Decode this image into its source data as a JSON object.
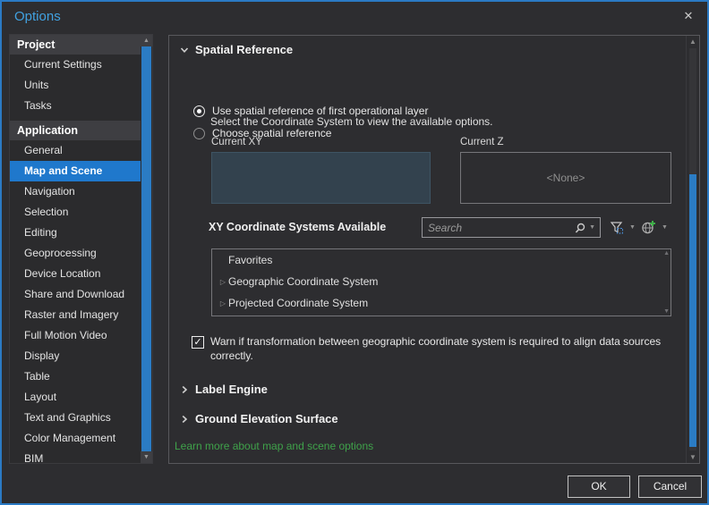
{
  "window": {
    "title": "Options",
    "close": "✕"
  },
  "sidebar": {
    "items": [
      {
        "label": "Project"
      },
      {
        "label": "Current Settings"
      },
      {
        "label": "Units"
      },
      {
        "label": "Tasks"
      },
      {
        "label": "Application"
      },
      {
        "label": "General"
      },
      {
        "label": "Map and Scene"
      },
      {
        "label": "Navigation"
      },
      {
        "label": "Selection"
      },
      {
        "label": "Editing"
      },
      {
        "label": "Geoprocessing"
      },
      {
        "label": "Device Location"
      },
      {
        "label": "Share and Download"
      },
      {
        "label": "Raster and Imagery"
      },
      {
        "label": "Full Motion Video"
      },
      {
        "label": "Display"
      },
      {
        "label": "Table"
      },
      {
        "label": "Layout"
      },
      {
        "label": "Text and Graphics"
      },
      {
        "label": "Color Management"
      },
      {
        "label": "BIM"
      }
    ],
    "selected": "Map and Scene"
  },
  "main": {
    "spatial_reference": {
      "title": "Spatial Reference",
      "radio_first_layer": "Use spatial reference of first operational layer",
      "radio_first_layer_selected": true,
      "radio_choose": "Choose spatial reference",
      "radio_choose_selected": false,
      "hint": "Select the Coordinate System to view the available options.",
      "current_xy_label": "Current XY",
      "current_z_label": "Current Z",
      "current_z_value": "<None>",
      "xy_available_label": "XY Coordinate Systems Available",
      "search_placeholder": "Search",
      "tree": [
        "Favorites",
        "Geographic Coordinate System",
        "Projected Coordinate System"
      ],
      "warn_text": "Warn if transformation between geographic coordinate system is required to align data sources correctly.",
      "warn_checked": true
    },
    "label_engine_title": "Label Engine",
    "ground_elevation_title": "Ground Elevation Surface",
    "learn_more": "Learn more about map and scene options"
  },
  "footer": {
    "ok": "OK",
    "cancel": "Cancel"
  },
  "colors": {
    "accent_blue": "#2b7ac4",
    "selection_blue": "#1f78cc",
    "title_blue": "#41a1e0",
    "link_green": "#3fa24a",
    "xy_box_fill": "#33424e"
  }
}
